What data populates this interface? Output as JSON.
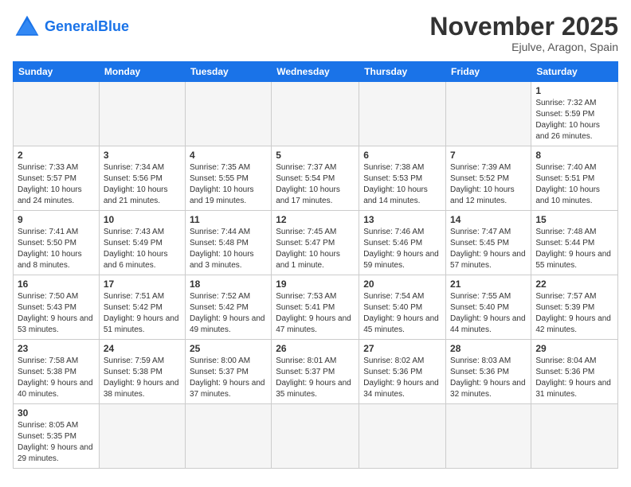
{
  "header": {
    "logo_general": "General",
    "logo_blue": "Blue",
    "month_title": "November 2025",
    "location": "Ejulve, Aragon, Spain"
  },
  "days_of_week": [
    "Sunday",
    "Monday",
    "Tuesday",
    "Wednesday",
    "Thursday",
    "Friday",
    "Saturday"
  ],
  "weeks": [
    [
      {
        "day": "",
        "info": ""
      },
      {
        "day": "",
        "info": ""
      },
      {
        "day": "",
        "info": ""
      },
      {
        "day": "",
        "info": ""
      },
      {
        "day": "",
        "info": ""
      },
      {
        "day": "",
        "info": ""
      },
      {
        "day": "1",
        "info": "Sunrise: 7:32 AM\nSunset: 5:59 PM\nDaylight: 10 hours and 26 minutes."
      }
    ],
    [
      {
        "day": "2",
        "info": "Sunrise: 7:33 AM\nSunset: 5:57 PM\nDaylight: 10 hours and 24 minutes."
      },
      {
        "day": "3",
        "info": "Sunrise: 7:34 AM\nSunset: 5:56 PM\nDaylight: 10 hours and 21 minutes."
      },
      {
        "day": "4",
        "info": "Sunrise: 7:35 AM\nSunset: 5:55 PM\nDaylight: 10 hours and 19 minutes."
      },
      {
        "day": "5",
        "info": "Sunrise: 7:37 AM\nSunset: 5:54 PM\nDaylight: 10 hours and 17 minutes."
      },
      {
        "day": "6",
        "info": "Sunrise: 7:38 AM\nSunset: 5:53 PM\nDaylight: 10 hours and 14 minutes."
      },
      {
        "day": "7",
        "info": "Sunrise: 7:39 AM\nSunset: 5:52 PM\nDaylight: 10 hours and 12 minutes."
      },
      {
        "day": "8",
        "info": "Sunrise: 7:40 AM\nSunset: 5:51 PM\nDaylight: 10 hours and 10 minutes."
      }
    ],
    [
      {
        "day": "9",
        "info": "Sunrise: 7:41 AM\nSunset: 5:50 PM\nDaylight: 10 hours and 8 minutes."
      },
      {
        "day": "10",
        "info": "Sunrise: 7:43 AM\nSunset: 5:49 PM\nDaylight: 10 hours and 6 minutes."
      },
      {
        "day": "11",
        "info": "Sunrise: 7:44 AM\nSunset: 5:48 PM\nDaylight: 10 hours and 3 minutes."
      },
      {
        "day": "12",
        "info": "Sunrise: 7:45 AM\nSunset: 5:47 PM\nDaylight: 10 hours and 1 minute."
      },
      {
        "day": "13",
        "info": "Sunrise: 7:46 AM\nSunset: 5:46 PM\nDaylight: 9 hours and 59 minutes."
      },
      {
        "day": "14",
        "info": "Sunrise: 7:47 AM\nSunset: 5:45 PM\nDaylight: 9 hours and 57 minutes."
      },
      {
        "day": "15",
        "info": "Sunrise: 7:48 AM\nSunset: 5:44 PM\nDaylight: 9 hours and 55 minutes."
      }
    ],
    [
      {
        "day": "16",
        "info": "Sunrise: 7:50 AM\nSunset: 5:43 PM\nDaylight: 9 hours and 53 minutes."
      },
      {
        "day": "17",
        "info": "Sunrise: 7:51 AM\nSunset: 5:42 PM\nDaylight: 9 hours and 51 minutes."
      },
      {
        "day": "18",
        "info": "Sunrise: 7:52 AM\nSunset: 5:42 PM\nDaylight: 9 hours and 49 minutes."
      },
      {
        "day": "19",
        "info": "Sunrise: 7:53 AM\nSunset: 5:41 PM\nDaylight: 9 hours and 47 minutes."
      },
      {
        "day": "20",
        "info": "Sunrise: 7:54 AM\nSunset: 5:40 PM\nDaylight: 9 hours and 45 minutes."
      },
      {
        "day": "21",
        "info": "Sunrise: 7:55 AM\nSunset: 5:40 PM\nDaylight: 9 hours and 44 minutes."
      },
      {
        "day": "22",
        "info": "Sunrise: 7:57 AM\nSunset: 5:39 PM\nDaylight: 9 hours and 42 minutes."
      }
    ],
    [
      {
        "day": "23",
        "info": "Sunrise: 7:58 AM\nSunset: 5:38 PM\nDaylight: 9 hours and 40 minutes."
      },
      {
        "day": "24",
        "info": "Sunrise: 7:59 AM\nSunset: 5:38 PM\nDaylight: 9 hours and 38 minutes."
      },
      {
        "day": "25",
        "info": "Sunrise: 8:00 AM\nSunset: 5:37 PM\nDaylight: 9 hours and 37 minutes."
      },
      {
        "day": "26",
        "info": "Sunrise: 8:01 AM\nSunset: 5:37 PM\nDaylight: 9 hours and 35 minutes."
      },
      {
        "day": "27",
        "info": "Sunrise: 8:02 AM\nSunset: 5:36 PM\nDaylight: 9 hours and 34 minutes."
      },
      {
        "day": "28",
        "info": "Sunrise: 8:03 AM\nSunset: 5:36 PM\nDaylight: 9 hours and 32 minutes."
      },
      {
        "day": "29",
        "info": "Sunrise: 8:04 AM\nSunset: 5:36 PM\nDaylight: 9 hours and 31 minutes."
      }
    ],
    [
      {
        "day": "30",
        "info": "Sunrise: 8:05 AM\nSunset: 5:35 PM\nDaylight: 9 hours and 29 minutes."
      },
      {
        "day": "",
        "info": ""
      },
      {
        "day": "",
        "info": ""
      },
      {
        "day": "",
        "info": ""
      },
      {
        "day": "",
        "info": ""
      },
      {
        "day": "",
        "info": ""
      },
      {
        "day": "",
        "info": ""
      }
    ]
  ]
}
